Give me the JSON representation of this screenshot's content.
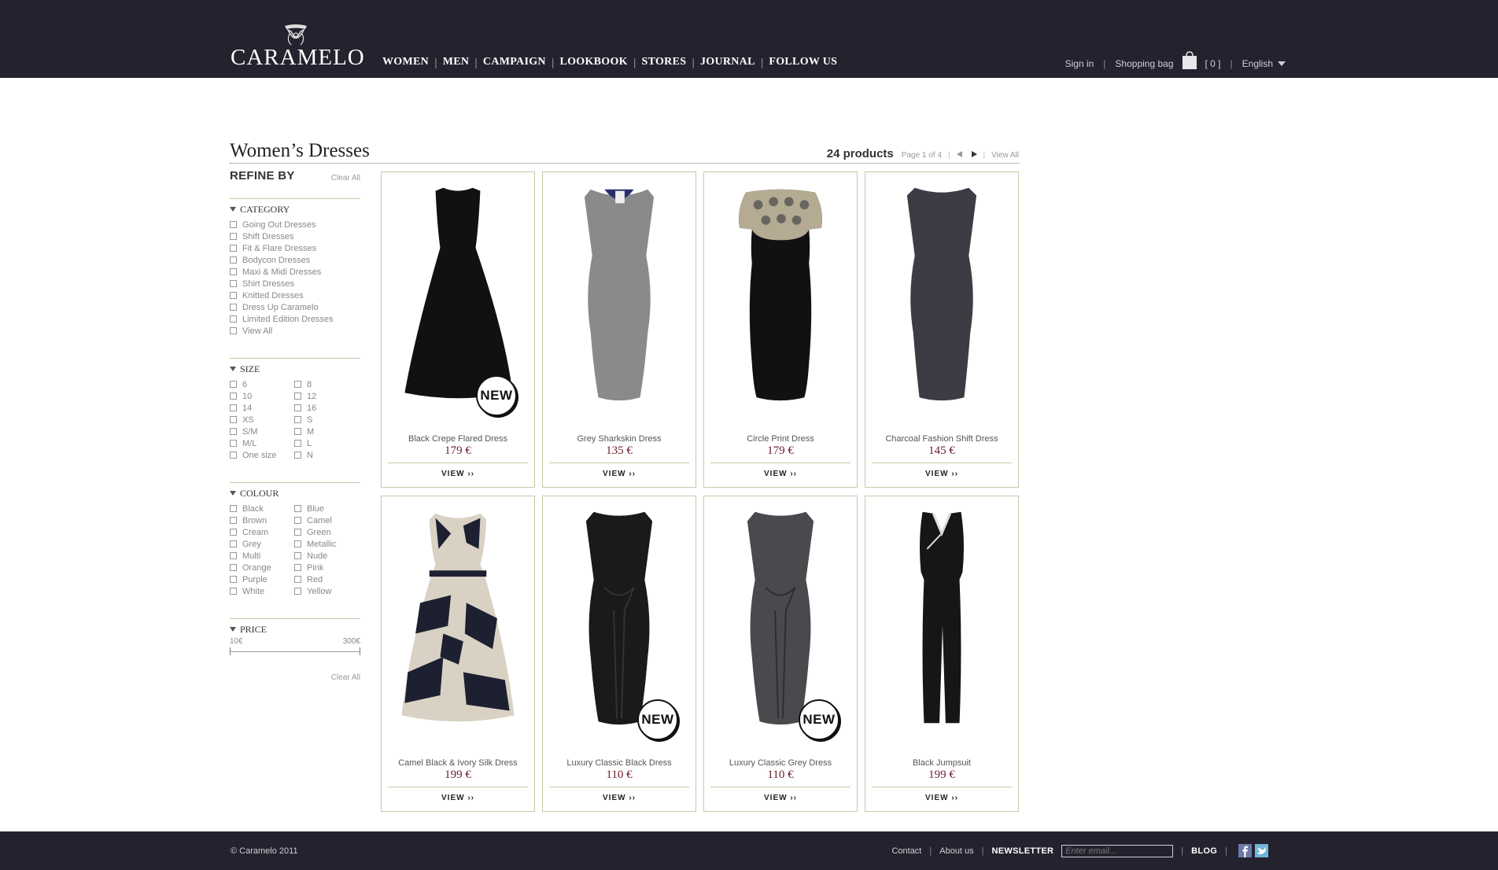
{
  "header": {
    "brand": "CARAMELO",
    "nav": [
      "WOMEN",
      "MEN",
      "CAMPAIGN",
      "LOOKBOOK",
      "STORES",
      "JOURNAL",
      "FOLLOW US"
    ],
    "sign_in": "Sign in",
    "shopping_bag": "Shopping bag",
    "bag_count": "[ 0 ]",
    "language": "English"
  },
  "page": {
    "title": "Women’s Dresses",
    "product_count": "24 products",
    "page_info": "Page 1 of 4",
    "view_all": "View All"
  },
  "sidebar": {
    "refine_title": "REFINE BY",
    "clear_all": "Clear All",
    "category": {
      "title": "CATEGORY",
      "options": [
        "Going Out Dresses",
        "Shift Dresses",
        "Fit & Flare Dresses",
        "Bodycon Dresses",
        "Maxi & Midi Dresses",
        "Shirt Dresses",
        "Knitted Dresses",
        "Dress Up Caramelo",
        "Limited Edition Dresses",
        "View All"
      ]
    },
    "size": {
      "title": "SIZE",
      "options": [
        "6",
        "8",
        "10",
        "12",
        "14",
        "16",
        "XS",
        "S",
        "S/M",
        "M",
        "M/L",
        "L",
        "One size",
        "N"
      ]
    },
    "colour": {
      "title": "COLOUR",
      "options": [
        "Black",
        "Blue",
        "Brown",
        "Camel",
        "Cream",
        "Green",
        "Grey",
        "Metallic",
        "Multi",
        "Nude",
        "Orange",
        "Pink",
        "Purple",
        "Red",
        "White",
        "Yellow"
      ]
    },
    "price": {
      "title": "PRICE",
      "min": "10€",
      "max": "300€"
    },
    "clear_all_bottom": "Clear All"
  },
  "products": [
    {
      "name": "Black Crepe Flared Dress",
      "price": "179 €",
      "view": "VIEW ››",
      "badge": "NEW"
    },
    {
      "name": "Grey Sharkskin Dress",
      "price": "135 €",
      "view": "VIEW ››",
      "badge": ""
    },
    {
      "name": "Circle Print Dress",
      "price": "179 €",
      "view": "VIEW ››",
      "badge": ""
    },
    {
      "name": "Charcoal Fashion Shift Dress",
      "price": "145 €",
      "view": "VIEW ››",
      "badge": ""
    },
    {
      "name": "Camel Black & Ivory Silk Dress",
      "price": "199 €",
      "view": "VIEW ››",
      "badge": ""
    },
    {
      "name": "Luxury Classic Black Dress",
      "price": "110 €",
      "view": "VIEW ››",
      "badge": "NEW"
    },
    {
      "name": "Luxury Classic Grey Dress",
      "price": "110 €",
      "view": "VIEW ››",
      "badge": "NEW"
    },
    {
      "name": "Black Jumpsuit",
      "price": "199 €",
      "view": "VIEW ››",
      "badge": ""
    }
  ],
  "footer": {
    "copyright": "© Caramelo 2011",
    "contact": "Contact",
    "about": "About us",
    "newsletter": "NEWSLETTER",
    "email_placeholder": "Enter email...",
    "blog": "BLOG"
  },
  "colors": {
    "header_bg": "#23222e",
    "price": "#6b1d2c",
    "card_border": "#c7c9a7"
  }
}
